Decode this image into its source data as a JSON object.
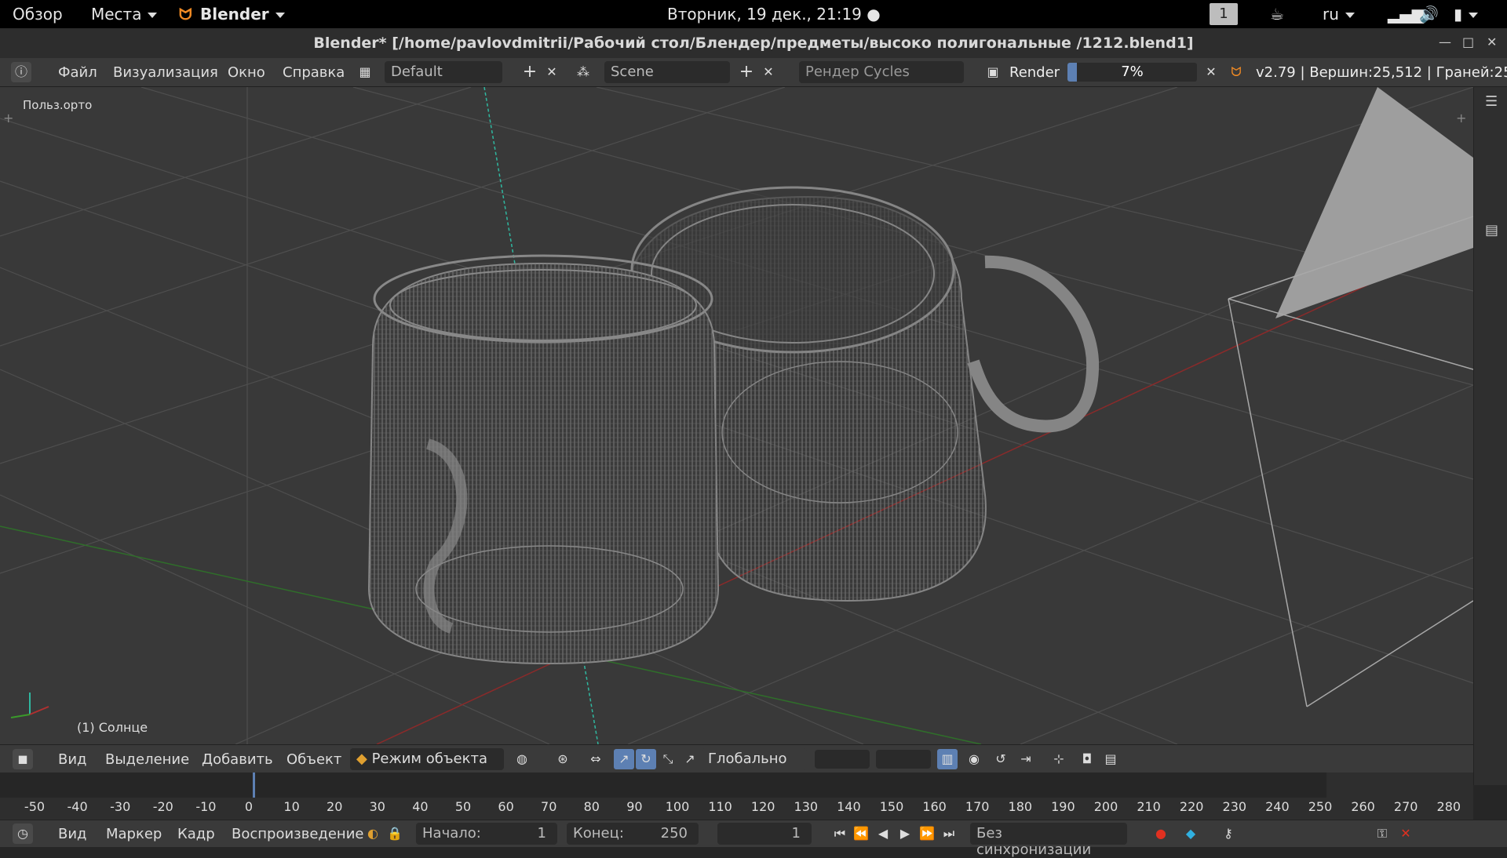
{
  "topbar": {
    "overview": "Обзор",
    "places": "Места",
    "app": "Blender",
    "clock": "Вторник, 19 дек., 21:19",
    "workspace": "1",
    "lang": "ru"
  },
  "window": {
    "title": "Blender* [/home/pavlovdmitrii/Рабочий стол/Блендер/предметы/высоко полигональные /1212.blend1]"
  },
  "info": {
    "menu": [
      "Файл",
      "Визуализация",
      "Окно",
      "Справка"
    ],
    "layout": "Default",
    "scene": "Scene",
    "engine": "Рендер Cycles",
    "render_label": "Render",
    "progress": 0.07,
    "progress_text": "7%",
    "stats": "v2.79 | Вершин:25,512 | Граней:25"
  },
  "viewport": {
    "view_name": "Польз.орто",
    "object_label": "(1) Солнце"
  },
  "header3d": {
    "menu": [
      "Вид",
      "Выделение",
      "Добавить",
      "Объект"
    ],
    "mode": "Режим объекта",
    "orientation": "Глобально"
  },
  "timeline": {
    "ticks": [
      "-50",
      "-40",
      "-30",
      "-20",
      "-10",
      "0",
      "10",
      "20",
      "30",
      "40",
      "50",
      "60",
      "70",
      "80",
      "90",
      "100",
      "110",
      "120",
      "130",
      "140",
      "150",
      "160",
      "170",
      "180",
      "190",
      "200",
      "210",
      "220",
      "230",
      "240",
      "250",
      "260",
      "270",
      "280"
    ],
    "menu": [
      "Вид",
      "Маркер",
      "Кадр",
      "Воспроизведение"
    ],
    "start_label": "Начало:",
    "start_value": "1",
    "end_label": "Конец:",
    "end_value": "250",
    "current_frame": "1",
    "sync": "Без синхронизации"
  },
  "colors": {
    "accent": "#5d80b3",
    "x_axis": "#a02020",
    "y_axis": "#3a8a2a",
    "z_axis": "#2fb8a0"
  }
}
